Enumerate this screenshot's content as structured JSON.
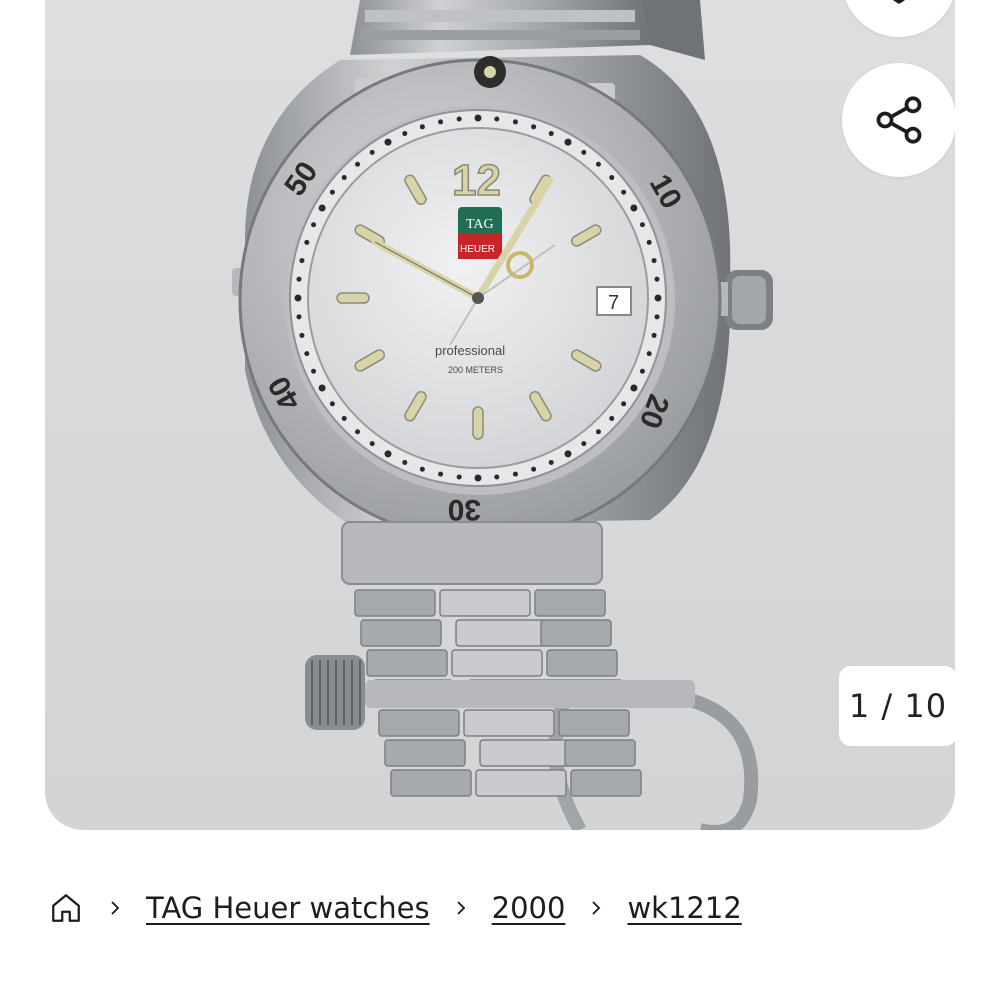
{
  "gallery": {
    "counter": "1 / 10",
    "image_alt": "TAG Heuer Professional 200 Meters watch"
  },
  "icons": {
    "favorite": "heart-icon",
    "share": "share-icon",
    "home": "home-icon",
    "separator": "chevron-right-icon"
  },
  "breadcrumb": {
    "items": [
      "TAG Heuer watches",
      "2000",
      "wk1212"
    ]
  },
  "watch": {
    "bezel_numbers": [
      "50",
      "10",
      "20",
      "30",
      "40"
    ],
    "brand_line1": "TAG",
    "brand_line2": "HEUER",
    "model": "professional",
    "depth": "200 METERS",
    "date": "7",
    "hour_twelve": "12"
  }
}
